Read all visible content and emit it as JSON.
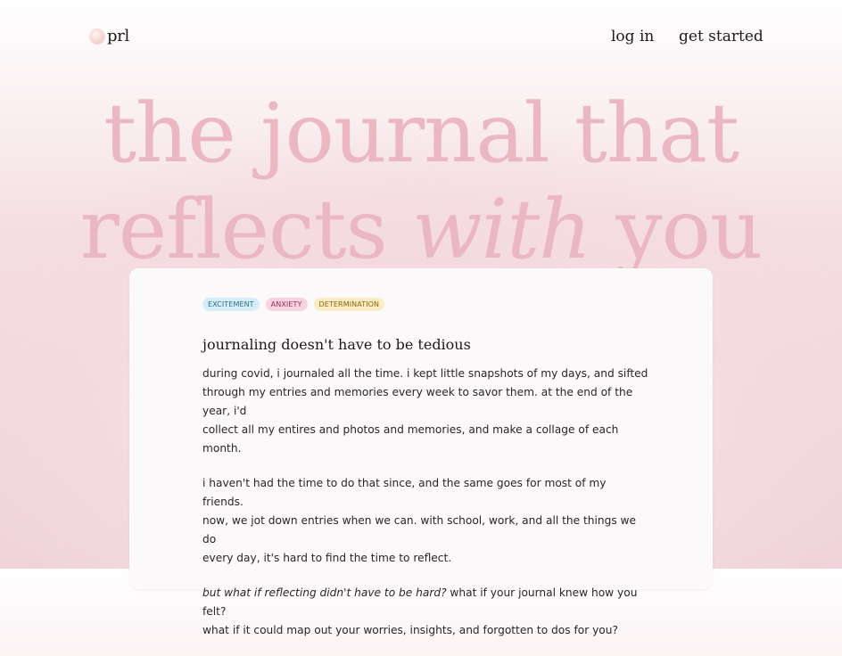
{
  "nav": {
    "logo_text": "prl",
    "login_label": "log in",
    "get_started_label": "get started"
  },
  "hero": {
    "line1": "the journal that",
    "line2_start": "reflects ",
    "line2_italic": "with",
    "line2_end": " you"
  },
  "card": {
    "tags": [
      {
        "label": "EXCITEMENT",
        "color": "#d6eef7"
      },
      {
        "label": "ANXIETY",
        "color": "#f7d3e2"
      },
      {
        "label": "DETERMINATION",
        "color": "#faedc4"
      }
    ],
    "title": "journaling doesn't have to be tedious",
    "paragraphs": [
      {
        "line1": "during covid, i journaled all the time. i kept little snapshots of my days, and sifted",
        "line2": "through my entries and memories every week to savor them. at the end of the year, i'd",
        "line3": "collect all my entires and photos and memories, and make a collage of each month."
      },
      {
        "line1": "i haven't had the time to do that since, and the same goes for most of my friends.",
        "line2": "now, we jot down entries when we can. with school, work, and all the things we do",
        "line3": "every day, it's hard to find the time to reflect."
      },
      {
        "line1_italic": "but what if reflecting didn't have to be hard?",
        "line1_rest": " what if your journal knew how you felt?",
        "line2": "what if it could map out your worries, insights, and forgotten to dos for you?"
      }
    ]
  },
  "colors": {
    "hero_text": "#eab7c3",
    "background_pink": "#efd2d9",
    "card_bg": "#fcf9fa"
  }
}
